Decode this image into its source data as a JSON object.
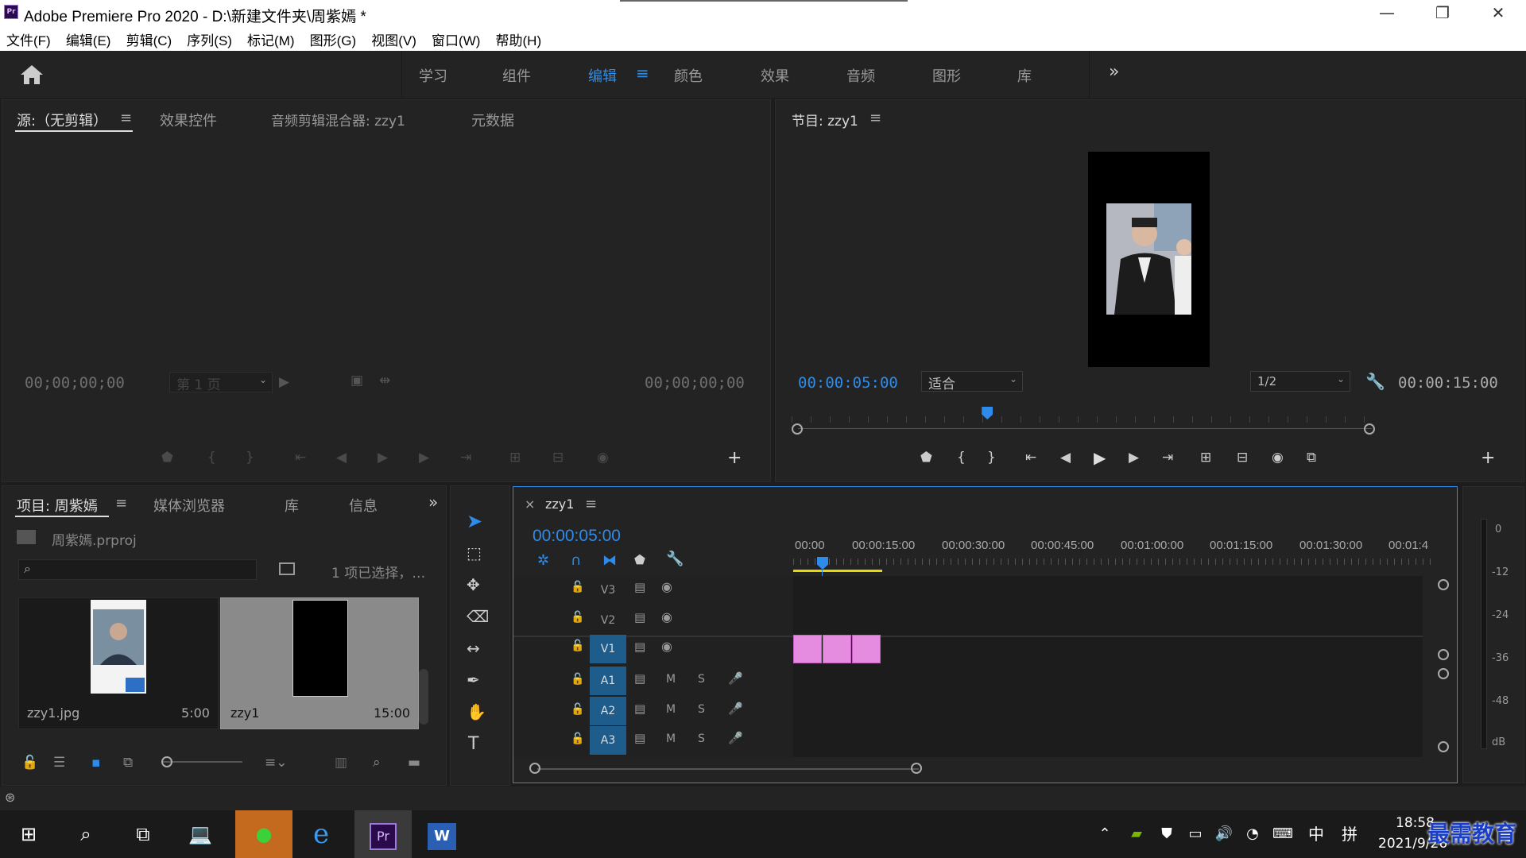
{
  "window": {
    "title": "Adobe Premiere Pro 2020 - D:\\新建文件夹\\周紫嫣 *",
    "minimize": "—",
    "maximize": "❐",
    "close": "✕"
  },
  "menu": [
    "文件(F)",
    "编辑(E)",
    "剪辑(C)",
    "序列(S)",
    "标记(M)",
    "图形(G)",
    "视图(V)",
    "窗口(W)",
    "帮助(H)"
  ],
  "workspaces": [
    {
      "label": "学习"
    },
    {
      "label": "组件"
    },
    {
      "label": "编辑",
      "active": true
    },
    {
      "label": "颜色"
    },
    {
      "label": "效果"
    },
    {
      "label": "音频"
    },
    {
      "label": "图形"
    },
    {
      "label": "库"
    }
  ],
  "workspace_more": "»",
  "source": {
    "tabs": [
      "源:（无剪辑）",
      "效果控件",
      "音频剪辑混合器: zzy1",
      "元数据"
    ],
    "tc_left": "00;00;00;00",
    "tc_right": "00;00;00;00",
    "page": "第 1 页"
  },
  "program": {
    "title": "节目: zzy1",
    "timecode": "00:00:05:00",
    "zoom": "适合",
    "resolution": "1/2",
    "duration": "00:00:15:00",
    "playhead_fraction": 0.33
  },
  "project": {
    "tabs": [
      "项目: 周紫嫣",
      "媒体浏览器",
      "库",
      "信息"
    ],
    "file": "周紫嫣.prproj",
    "selection": "1 项已选择，…",
    "items": [
      {
        "name": "zzy1.jpg",
        "duration": "5:00"
      },
      {
        "name": "zzy1",
        "duration": "15:00"
      }
    ]
  },
  "timeline": {
    "tab": "zzy1",
    "close": "×",
    "timecode": "00:00:05:00",
    "ruler": [
      "00:00",
      "00:00:15:00",
      "00:00:30:00",
      "00:00:45:00",
      "00:01:00:00",
      "00:01:15:00",
      "00:01:30:00",
      "00:01:4"
    ],
    "video_tracks": [
      "V3",
      "V2",
      "V1"
    ],
    "audio_tracks": [
      "A1",
      "A2",
      "A3"
    ],
    "mute": "M",
    "solo": "S"
  },
  "meter": {
    "labels": [
      "0",
      "-12",
      "-24",
      "-36",
      "-48",
      "dB"
    ]
  },
  "taskbar": {
    "time": "18:58",
    "date": "2021/9/26",
    "ime": "中",
    "ime2": "拼",
    "watermark": "最需教育"
  }
}
